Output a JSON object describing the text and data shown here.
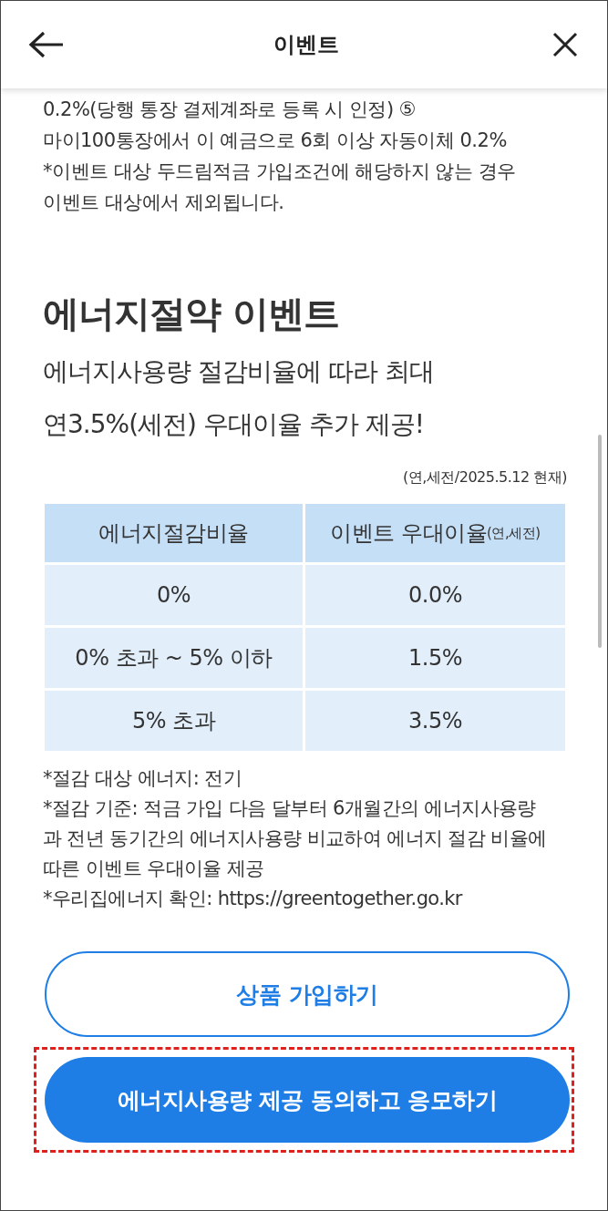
{
  "header": {
    "title": "이벤트"
  },
  "intro_lines": [
    "0.2%(당행 통장 결제계좌로 등록 시 인정) ⑤",
    "마이100통장에서 이 예금으로 6회 이상 자동이체 0.2%",
    "*이벤트 대상 두드림적금 가입조건에 해당하지 않는 경우",
    "이벤트 대상에서 제외됩니다."
  ],
  "section": {
    "title": "에너지절약 이벤트",
    "subtitle_lines": [
      "에너지사용량 절감비율에 따라 최대",
      "연3.5%(세전) 우대이율 추가 제공!"
    ],
    "note": "(연,세전/2025.5.12 현재)"
  },
  "table": {
    "columns": [
      {
        "label": "에너지절감비율"
      },
      {
        "label": "이벤트 우대이율",
        "suffix": "(연,세전)"
      }
    ],
    "rows": [
      [
        "0%",
        "0.0%"
      ],
      [
        "0% 초과 ~ 5% 이하",
        "1.5%"
      ],
      [
        "5% 초과",
        "3.5%"
      ]
    ]
  },
  "footnotes": [
    "*절감 대상 에너지: 전기",
    "*절감 기준: 적금 가입 다음 달부터 6개월간의 에너지사용량과 전년 동기간의 에너지사용량 비교하여 에너지 절감 비율에 따른 이벤트 우대이율 제공",
    "*우리집에너지 확인: https://greentogether.go.kr"
  ],
  "buttons": [
    {
      "label": "상품 가입하기",
      "kind": "outline",
      "highlighted": false
    },
    {
      "label": "에너지사용량 제공 동의하고 응모하기",
      "kind": "filled",
      "highlighted": true
    }
  ]
}
